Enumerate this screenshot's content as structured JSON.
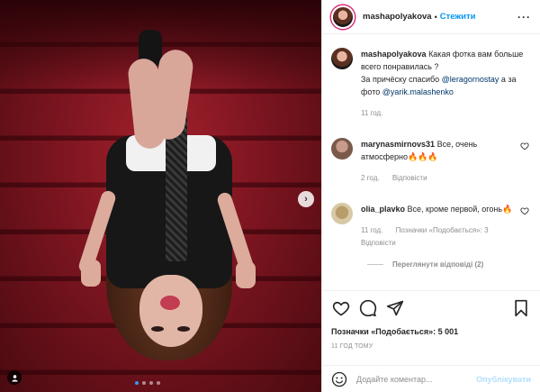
{
  "header": {
    "username": "mashapolyakova",
    "separator": "•",
    "follow_label": "Стежити",
    "more_label": "···"
  },
  "caption": {
    "username": "mashapolyakova",
    "text_1": "Какая фотка вам больше всего понравилась ?",
    "text_2": "За причёску спасибо",
    "mention_1": "@leragornostay",
    "text_3": "а за фото",
    "mention_2": "@yarik.malashenko",
    "time": "11 год."
  },
  "comments": [
    {
      "username": "marynasmirnovs31",
      "text": "Все, очень атмосферно🔥🔥🔥",
      "time": "2 год.",
      "reply_label": "Відповісти"
    },
    {
      "username": "olia_plavko",
      "text": "Все, кроме первой, огонь🔥",
      "time": "11 год.",
      "likes_label": "Позначки «Подобається»: 3",
      "reply_label": "Відповісти",
      "view_replies": "Переглянути відповіді (2)"
    }
  ],
  "actions": {
    "likes": "Позначки «Подобається»: 5 001",
    "timestamp": "11 ГОД ТОМУ"
  },
  "add_comment": {
    "placeholder": "Додайте коментар...",
    "post_label": "Опублікувати"
  },
  "carousel": {
    "slide_count": 4,
    "active_index": 0
  },
  "icons": [
    "heart-icon",
    "comment-icon",
    "share-icon",
    "bookmark-icon",
    "emoji-icon",
    "user-tag-icon",
    "chevron-right-icon"
  ]
}
